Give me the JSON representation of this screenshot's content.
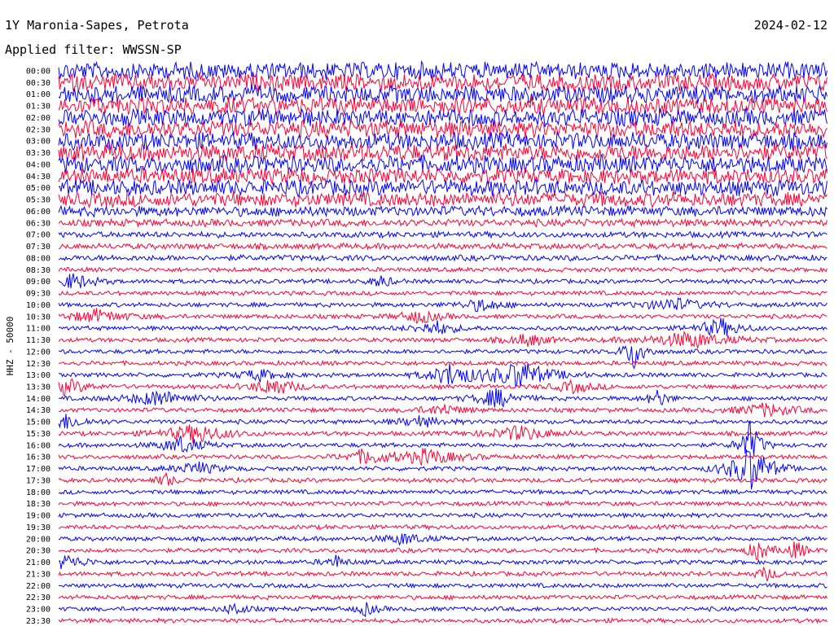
{
  "header": {
    "station": "1Y Maronia-Sapes, Petrota",
    "date": "2024-02-12",
    "filter": "Applied filter: WWSSN-SP"
  },
  "axis": {
    "ylabel": "HHZ - 50000"
  },
  "colors": {
    "even": "#0000ff",
    "odd": "#ff0033"
  },
  "chart_data": {
    "type": "line",
    "title": "1Y Maronia-Sapes, Petrota",
    "ylabel": "HHZ - 50000",
    "row_labels": [
      "00:00",
      "00:30",
      "01:00",
      "01:30",
      "02:00",
      "02:30",
      "03:00",
      "03:30",
      "04:00",
      "04:30",
      "05:00",
      "05:30",
      "06:00",
      "06:30",
      "07:00",
      "07:30",
      "08:00",
      "08:30",
      "09:00",
      "09:30",
      "10:00",
      "10:30",
      "11:00",
      "11:30",
      "12:00",
      "12:30",
      "13:00",
      "13:30",
      "14:00",
      "14:30",
      "15:00",
      "15:30",
      "16:00",
      "16:30",
      "17:00",
      "17:30",
      "18:00",
      "18:30",
      "19:00",
      "19:30",
      "20:00",
      "20:30",
      "21:00",
      "21:30",
      "22:00",
      "22:30",
      "23:00",
      "23:30"
    ],
    "row_noise": [
      12,
      12,
      12,
      12,
      12,
      12,
      12,
      12,
      12,
      11,
      11,
      10,
      7,
      5,
      4,
      4,
      4,
      3,
      3,
      3,
      3,
      3,
      3,
      3,
      3,
      3,
      3,
      3,
      3,
      3,
      3,
      3,
      3,
      3,
      3,
      3,
      3,
      3,
      3,
      3,
      3,
      3,
      3,
      3,
      3,
      3,
      3,
      3
    ],
    "events": [
      {
        "row": 18,
        "x": 0.02,
        "amp": 10,
        "width": 0.02
      },
      {
        "row": 18,
        "x": 0.42,
        "amp": 8,
        "width": 0.01
      },
      {
        "row": 20,
        "x": 0.55,
        "amp": 8,
        "width": 0.02
      },
      {
        "row": 20,
        "x": 0.8,
        "amp": 8,
        "width": 0.03
      },
      {
        "row": 21,
        "x": 0.05,
        "amp": 8,
        "width": 0.03
      },
      {
        "row": 21,
        "x": 0.47,
        "amp": 8,
        "width": 0.02
      },
      {
        "row": 22,
        "x": 0.49,
        "amp": 9,
        "width": 0.02
      },
      {
        "row": 22,
        "x": 0.86,
        "amp": 12,
        "width": 0.02
      },
      {
        "row": 23,
        "x": 0.61,
        "amp": 8,
        "width": 0.02
      },
      {
        "row": 23,
        "x": 0.82,
        "amp": 10,
        "width": 0.04
      },
      {
        "row": 24,
        "x": 0.75,
        "amp": 25,
        "width": 0.01
      },
      {
        "row": 26,
        "x": 0.26,
        "amp": 7,
        "width": 0.02
      },
      {
        "row": 26,
        "x": 0.51,
        "amp": 15,
        "width": 0.02
      },
      {
        "row": 26,
        "x": 0.6,
        "amp": 18,
        "width": 0.03
      },
      {
        "row": 27,
        "x": 0.01,
        "amp": 10,
        "width": 0.02
      },
      {
        "row": 27,
        "x": 0.28,
        "amp": 12,
        "width": 0.02
      },
      {
        "row": 27,
        "x": 0.67,
        "amp": 7,
        "width": 0.02
      },
      {
        "row": 28,
        "x": 0.13,
        "amp": 10,
        "width": 0.03
      },
      {
        "row": 28,
        "x": 0.57,
        "amp": 12,
        "width": 0.02
      },
      {
        "row": 28,
        "x": 0.78,
        "amp": 11,
        "width": 0.01
      },
      {
        "row": 29,
        "x": 0.5,
        "amp": 7,
        "width": 0.02
      },
      {
        "row": 29,
        "x": 0.92,
        "amp": 8,
        "width": 0.03
      },
      {
        "row": 30,
        "x": 0.01,
        "amp": 9,
        "width": 0.02
      },
      {
        "row": 30,
        "x": 0.47,
        "amp": 7,
        "width": 0.02
      },
      {
        "row": 31,
        "x": 0.18,
        "amp": 12,
        "width": 0.03
      },
      {
        "row": 31,
        "x": 0.6,
        "amp": 9,
        "width": 0.03
      },
      {
        "row": 32,
        "x": 0.16,
        "amp": 11,
        "width": 0.02
      },
      {
        "row": 32,
        "x": 0.9,
        "amp": 30,
        "width": 0.01
      },
      {
        "row": 33,
        "x": 0.4,
        "amp": 9,
        "width": 0.02
      },
      {
        "row": 33,
        "x": 0.48,
        "amp": 10,
        "width": 0.03
      },
      {
        "row": 34,
        "x": 0.9,
        "amp": 30,
        "width": 0.02
      },
      {
        "row": 34,
        "x": 0.18,
        "amp": 8,
        "width": 0.02
      },
      {
        "row": 35,
        "x": 0.14,
        "amp": 8,
        "width": 0.01
      },
      {
        "row": 40,
        "x": 0.45,
        "amp": 7,
        "width": 0.02
      },
      {
        "row": 41,
        "x": 0.91,
        "amp": 14,
        "width": 0.01
      },
      {
        "row": 41,
        "x": 0.96,
        "amp": 12,
        "width": 0.01
      },
      {
        "row": 42,
        "x": 0.01,
        "amp": 9,
        "width": 0.02
      },
      {
        "row": 42,
        "x": 0.36,
        "amp": 8,
        "width": 0.01
      },
      {
        "row": 43,
        "x": 0.92,
        "amp": 9,
        "width": 0.01
      },
      {
        "row": 46,
        "x": 0.23,
        "amp": 9,
        "width": 0.01
      },
      {
        "row": 46,
        "x": 0.4,
        "amp": 8,
        "width": 0.01
      }
    ]
  }
}
